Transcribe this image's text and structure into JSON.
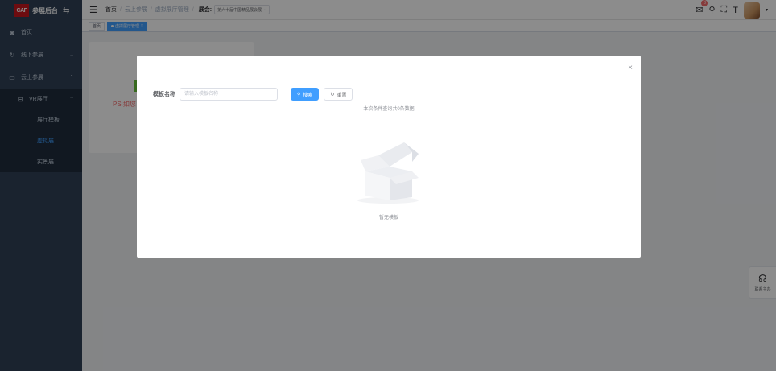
{
  "brand": {
    "logo_text": "CAF",
    "title": "参展后台",
    "toggle_icon": "swap-icon"
  },
  "sidebar": {
    "items": [
      {
        "label": "首页",
        "icon": "dashboard-icon"
      },
      {
        "label": "线下参展",
        "icon": "offline-icon"
      },
      {
        "label": "云上参展",
        "icon": "cloud-icon"
      }
    ],
    "vr": {
      "label": "VR展厅",
      "icon": "vr-icon"
    },
    "vr_children": [
      {
        "label": "展厅模板"
      },
      {
        "label": "虚拟展..."
      },
      {
        "label": "实景展..."
      }
    ]
  },
  "header": {
    "breadcrumb": [
      "首页",
      "云上参展",
      "虚拟展厅管理"
    ],
    "separator": "/",
    "exhibit_label": "展会:",
    "exhibit_value": "第六十届中国精品展会展"
  },
  "tags": {
    "home": "首页",
    "active": "虚拟展厅管理"
  },
  "notifications": {
    "count": "8"
  },
  "background": {
    "ps_text": "PS:如您"
  },
  "dialog": {
    "label": "模板名称",
    "input_placeholder": "请输入模板名称",
    "search_label": "搜索",
    "reset_label": "重置",
    "result_text": "本次条件查询共0条数据",
    "empty_text": "暂无模板"
  },
  "contact": {
    "label": "联系主办"
  },
  "colors": {
    "primary": "#409eff",
    "sidebar": "#304156",
    "danger": "#f56c6c",
    "success": "#67c23a"
  }
}
